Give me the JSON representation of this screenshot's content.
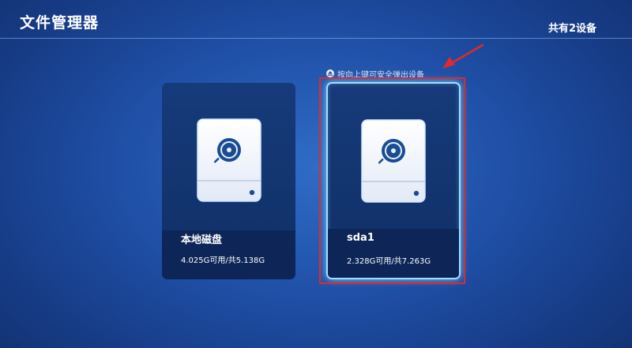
{
  "header": {
    "title": "文件管理器",
    "device_count": "共有2设备"
  },
  "eject_hint": {
    "icon": "eject-icon",
    "text": "按向上键可安全弹出设备"
  },
  "devices": [
    {
      "name": "本地磁盘",
      "capacity": "4.025G可用/共5.138G",
      "icon": "hard-disk-icon",
      "selected": false
    },
    {
      "name": "sda1",
      "capacity": "2.328G可用/共7.263G",
      "icon": "hard-disk-icon",
      "selected": true
    }
  ],
  "colors": {
    "selection_glow": "#9fe0ff",
    "annotation_red": "#e02a2a",
    "background": "#1f4fa6"
  }
}
